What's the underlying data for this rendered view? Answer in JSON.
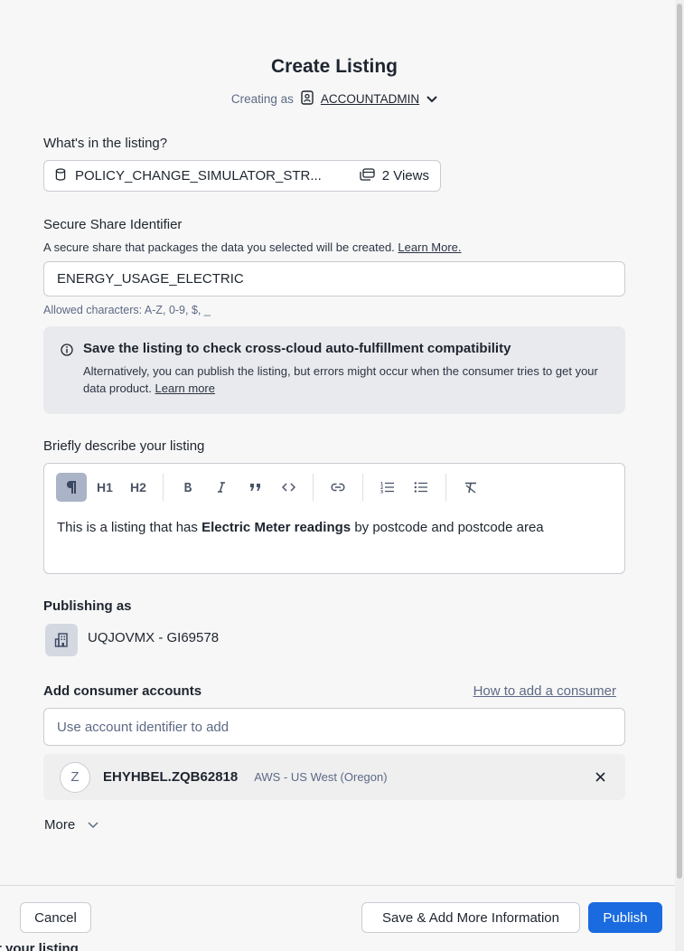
{
  "dialog": {
    "title": "Create Listing",
    "creating_as_prefix": "Creating as",
    "creating_as_role": "ACCOUNTADMIN"
  },
  "contents": {
    "label": "What's in the listing?",
    "database_name": "POLICY_CHANGE_SIMULATOR_STR...",
    "views_count": "2 Views"
  },
  "share": {
    "label": "Secure Share Identifier",
    "description": "A secure share that packages the data you selected will be created.",
    "learn_more": "Learn More.",
    "value": "ENERGY_USAGE_ELECTRIC",
    "hint": "Allowed characters: A-Z, 0-9, $, _"
  },
  "callout": {
    "title": "Save the listing to check cross-cloud auto-fulfillment compatibility",
    "body": "Alternatively, you can publish the listing, but errors might occur when the consumer tries to get your data product.",
    "learn_more": "Learn more"
  },
  "description": {
    "label": "Briefly describe your listing",
    "toolbar": {
      "h1": "H1",
      "h2": "H2"
    },
    "text_before": "This is a listing that has ",
    "text_bold": "Electric Meter readings",
    "text_after": " by postcode and postcode area"
  },
  "publishing": {
    "label": "Publishing as",
    "account": "UQJOVMX - GI69578"
  },
  "consumers": {
    "label": "Add consumer accounts",
    "help_link": "How to add a consumer",
    "input_placeholder": "Use account identifier to add",
    "items": [
      {
        "initial": "Z",
        "account": "EHYHBEL.ZQB62818",
        "region": "AWS - US West (Oregon)"
      }
    ]
  },
  "more_label": "More",
  "footer": {
    "cancel": "Cancel",
    "save_more": "Save & Add More Information",
    "publish": "Publish"
  },
  "background_text": "r your listing",
  "colors": {
    "accent": "#1a6be0",
    "muted_text": "#5d6a85",
    "callout_bg": "#e9eaed"
  }
}
